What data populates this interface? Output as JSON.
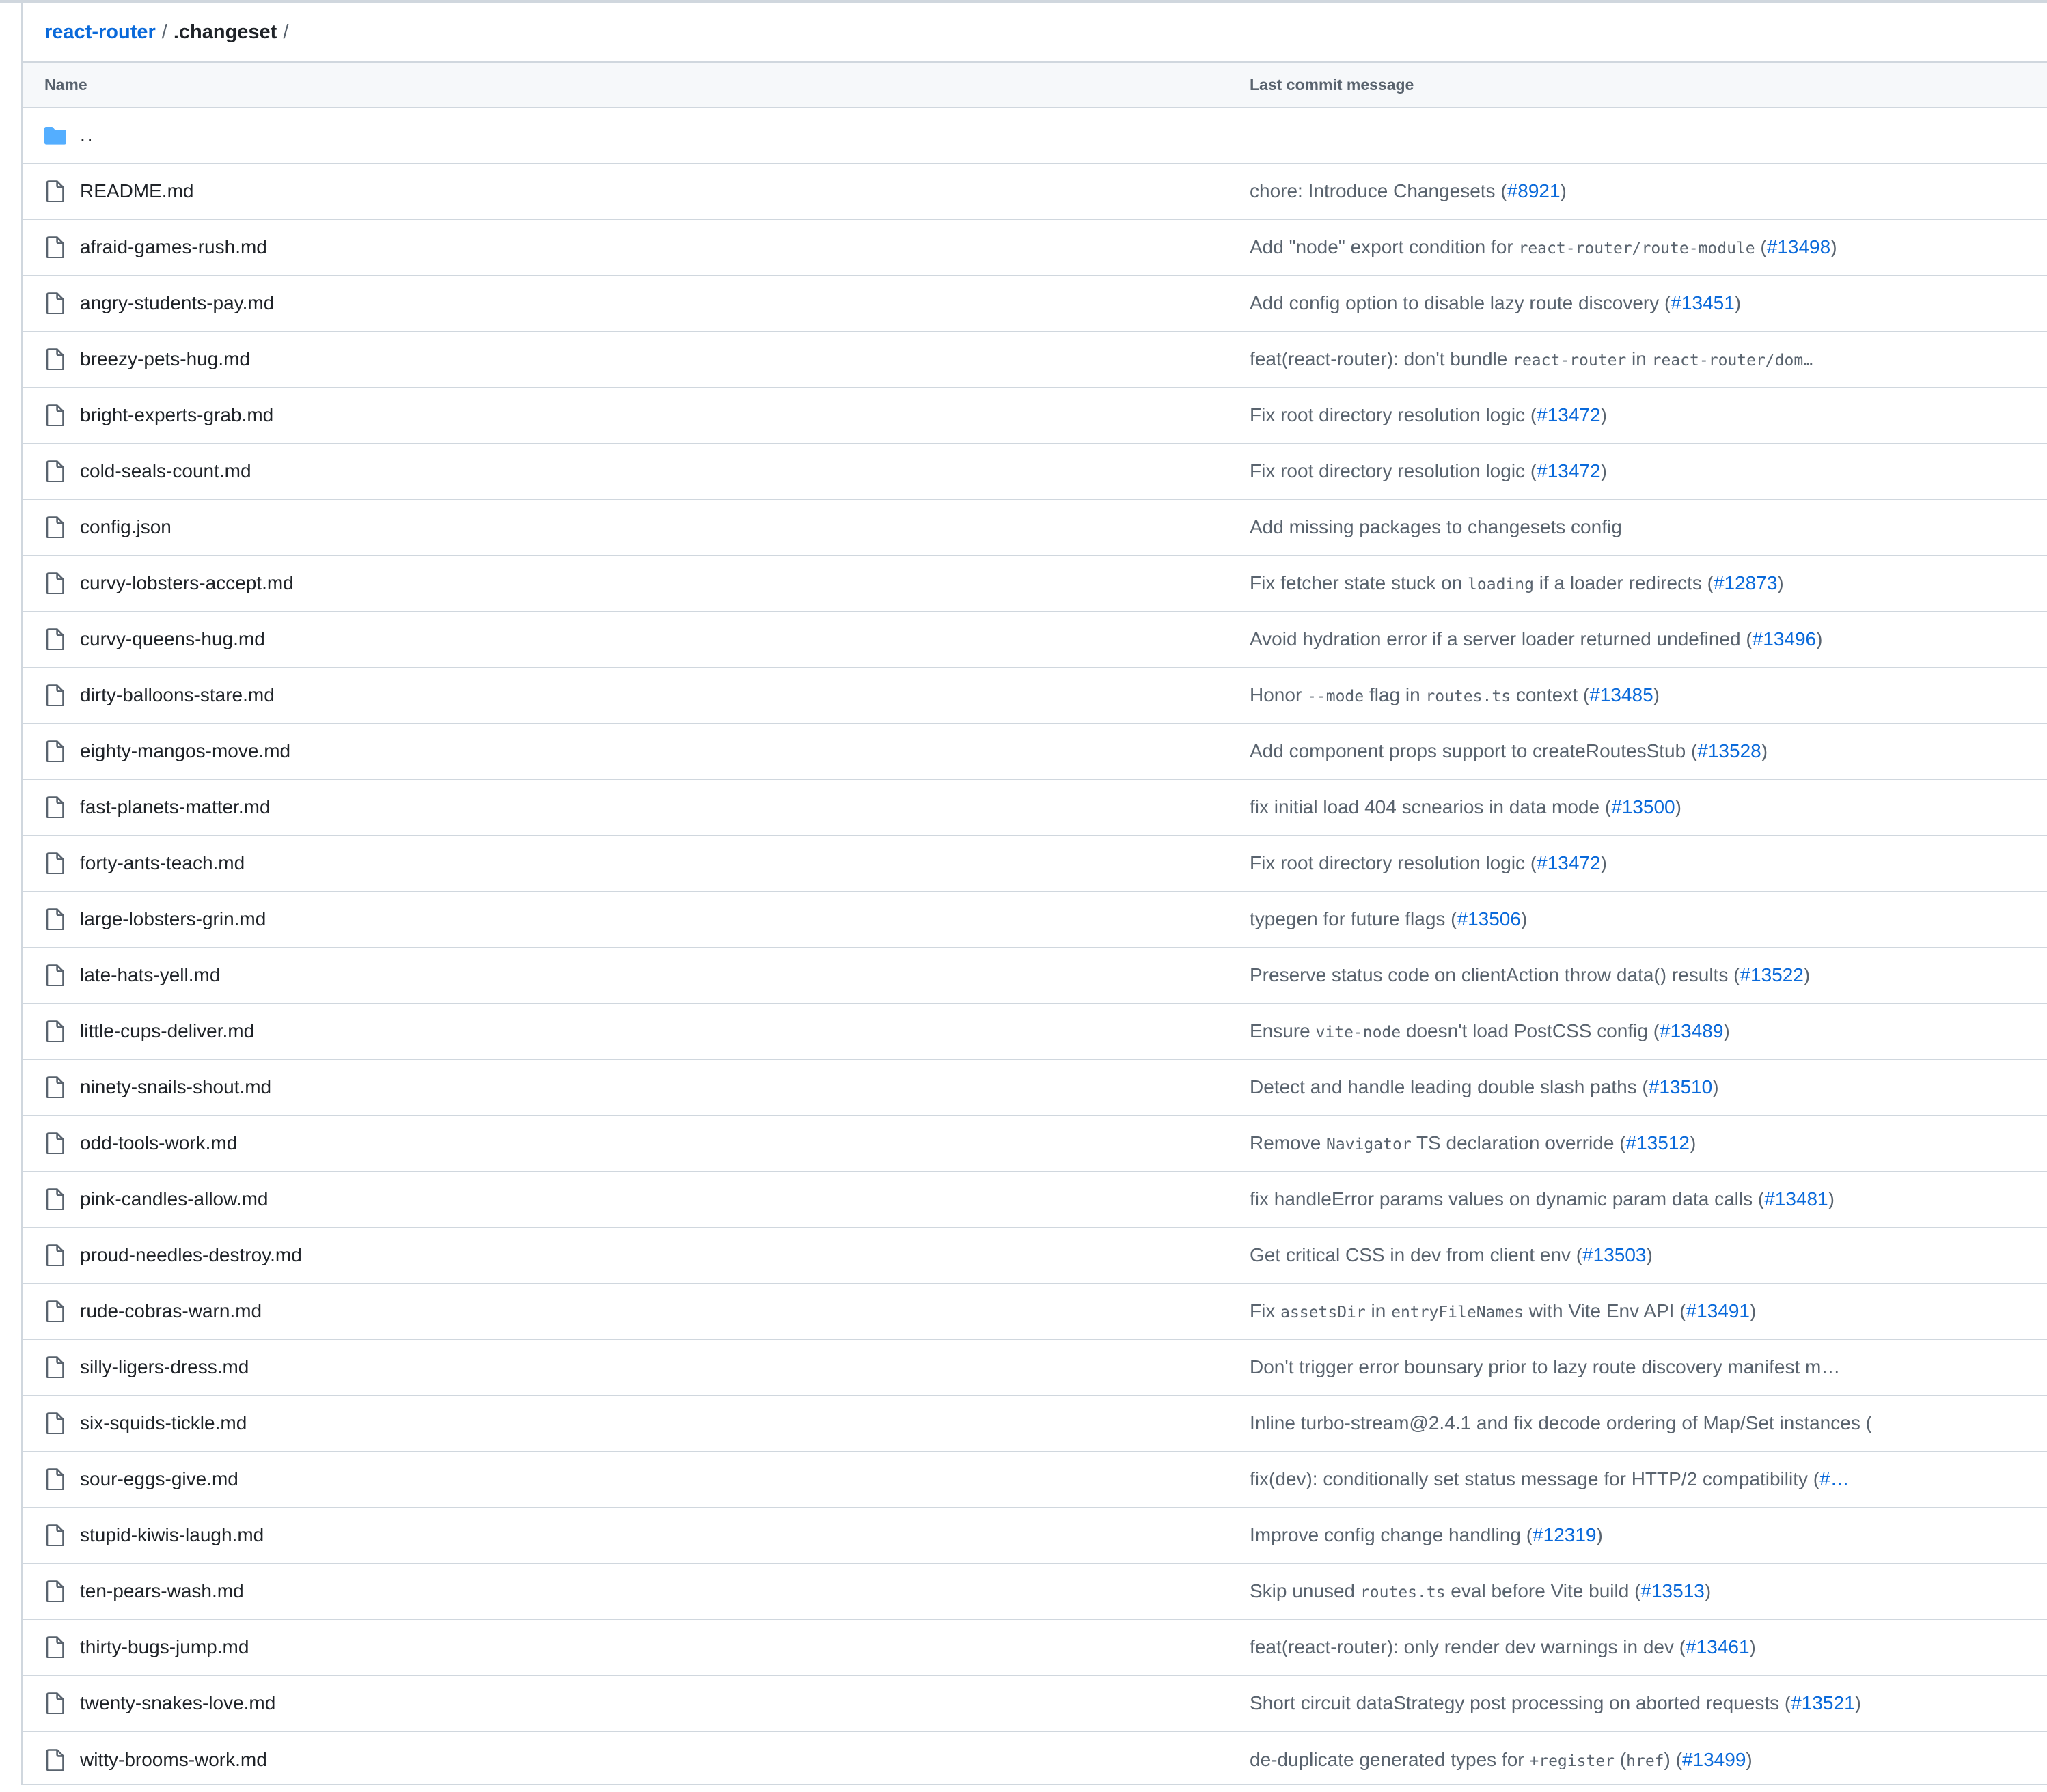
{
  "breadcrumb": {
    "repo": "react-router",
    "separator": "/",
    "folder": ".changeset",
    "trailing": "/"
  },
  "table": {
    "columns": {
      "name": "Name",
      "message": "Last commit message"
    },
    "parent_dir": "..",
    "rows": [
      {
        "name": "README.md",
        "message": [
          {
            "t": "chore: Introduce Changesets ("
          },
          {
            "t": "#8921",
            "pr": true
          },
          {
            "t": ")"
          }
        ]
      },
      {
        "name": "afraid-games-rush.md",
        "message": [
          {
            "t": "Add \"node\" export condition for "
          },
          {
            "t": "react-router/route-module",
            "code": true
          },
          {
            "t": " ("
          },
          {
            "t": "#13498",
            "pr": true
          },
          {
            "t": ")"
          }
        ]
      },
      {
        "name": "angry-students-pay.md",
        "message": [
          {
            "t": "Add config option to disable lazy route discovery ("
          },
          {
            "t": "#13451",
            "pr": true
          },
          {
            "t": ")"
          }
        ]
      },
      {
        "name": "breezy-pets-hug.md",
        "message": [
          {
            "t": "feat(react-router): don't bundle "
          },
          {
            "t": "react-router",
            "code": true
          },
          {
            "t": " in "
          },
          {
            "t": "react-router/dom…",
            "code": true
          }
        ]
      },
      {
        "name": "bright-experts-grab.md",
        "message": [
          {
            "t": "Fix root directory resolution logic ("
          },
          {
            "t": "#13472",
            "pr": true
          },
          {
            "t": ")"
          }
        ]
      },
      {
        "name": "cold-seals-count.md",
        "message": [
          {
            "t": "Fix root directory resolution logic ("
          },
          {
            "t": "#13472",
            "pr": true
          },
          {
            "t": ")"
          }
        ]
      },
      {
        "name": "config.json",
        "message": [
          {
            "t": "Add missing packages to changesets config"
          }
        ]
      },
      {
        "name": "curvy-lobsters-accept.md",
        "message": [
          {
            "t": "Fix fetcher state stuck on "
          },
          {
            "t": "loading",
            "code": true
          },
          {
            "t": " if a loader redirects ("
          },
          {
            "t": "#12873",
            "pr": true
          },
          {
            "t": ")"
          }
        ]
      },
      {
        "name": "curvy-queens-hug.md",
        "message": [
          {
            "t": "Avoid hydration error if a server loader returned undefined ("
          },
          {
            "t": "#13496",
            "pr": true
          },
          {
            "t": ")"
          }
        ]
      },
      {
        "name": "dirty-balloons-stare.md",
        "message": [
          {
            "t": "Honor "
          },
          {
            "t": "--mode",
            "code": true
          },
          {
            "t": " flag in "
          },
          {
            "t": "routes.ts",
            "code": true
          },
          {
            "t": " context ("
          },
          {
            "t": "#13485",
            "pr": true
          },
          {
            "t": ")"
          }
        ]
      },
      {
        "name": "eighty-mangos-move.md",
        "message": [
          {
            "t": "Add component props support to createRoutesStub ("
          },
          {
            "t": "#13528",
            "pr": true
          },
          {
            "t": ")"
          }
        ]
      },
      {
        "name": "fast-planets-matter.md",
        "message": [
          {
            "t": "fix initial load 404 scnearios in data mode ("
          },
          {
            "t": "#13500",
            "pr": true
          },
          {
            "t": ")"
          }
        ]
      },
      {
        "name": "forty-ants-teach.md",
        "message": [
          {
            "t": "Fix root directory resolution logic ("
          },
          {
            "t": "#13472",
            "pr": true
          },
          {
            "t": ")"
          }
        ]
      },
      {
        "name": "large-lobsters-grin.md",
        "message": [
          {
            "t": "typegen for future flags ("
          },
          {
            "t": "#13506",
            "pr": true
          },
          {
            "t": ")"
          }
        ]
      },
      {
        "name": "late-hats-yell.md",
        "message": [
          {
            "t": "Preserve status code on clientAction throw data() results ("
          },
          {
            "t": "#13522",
            "pr": true
          },
          {
            "t": ")"
          }
        ]
      },
      {
        "name": "little-cups-deliver.md",
        "message": [
          {
            "t": "Ensure "
          },
          {
            "t": "vite-node",
            "code": true
          },
          {
            "t": " doesn't load PostCSS config ("
          },
          {
            "t": "#13489",
            "pr": true
          },
          {
            "t": ")"
          }
        ]
      },
      {
        "name": "ninety-snails-shout.md",
        "message": [
          {
            "t": "Detect and handle leading double slash paths ("
          },
          {
            "t": "#13510",
            "pr": true
          },
          {
            "t": ")"
          }
        ]
      },
      {
        "name": "odd-tools-work.md",
        "message": [
          {
            "t": "Remove "
          },
          {
            "t": "Navigator",
            "code": true
          },
          {
            "t": " TS declaration override ("
          },
          {
            "t": "#13512",
            "pr": true
          },
          {
            "t": ")"
          }
        ]
      },
      {
        "name": "pink-candles-allow.md",
        "message": [
          {
            "t": "fix handleError params values on dynamic param data calls ("
          },
          {
            "t": "#13481",
            "pr": true
          },
          {
            "t": ")"
          }
        ]
      },
      {
        "name": "proud-needles-destroy.md",
        "message": [
          {
            "t": "Get critical CSS in dev from client env ("
          },
          {
            "t": "#13503",
            "pr": true
          },
          {
            "t": ")"
          }
        ]
      },
      {
        "name": "rude-cobras-warn.md",
        "message": [
          {
            "t": "Fix "
          },
          {
            "t": "assetsDir",
            "code": true
          },
          {
            "t": " in "
          },
          {
            "t": "entryFileNames",
            "code": true
          },
          {
            "t": " with Vite Env API ("
          },
          {
            "t": "#13491",
            "pr": true
          },
          {
            "t": ")"
          }
        ]
      },
      {
        "name": "silly-ligers-dress.md",
        "message": [
          {
            "t": "Don't trigger error bounsary prior to lazy route discovery manifest m…"
          }
        ]
      },
      {
        "name": "six-squids-tickle.md",
        "message": [
          {
            "t": "Inline turbo-stream@2.4.1 and fix decode ordering of Map/Set instances ("
          }
        ]
      },
      {
        "name": "sour-eggs-give.md",
        "message": [
          {
            "t": "fix(dev): conditionally set status message for HTTP/2 compatibility ("
          },
          {
            "t": "#…",
            "pr": true
          }
        ]
      },
      {
        "name": "stupid-kiwis-laugh.md",
        "message": [
          {
            "t": "Improve config change handling ("
          },
          {
            "t": "#12319",
            "pr": true
          },
          {
            "t": ")"
          }
        ]
      },
      {
        "name": "ten-pears-wash.md",
        "message": [
          {
            "t": "Skip unused "
          },
          {
            "t": "routes.ts",
            "code": true
          },
          {
            "t": " eval before Vite build ("
          },
          {
            "t": "#13513",
            "pr": true
          },
          {
            "t": ")"
          }
        ]
      },
      {
        "name": "thirty-bugs-jump.md",
        "message": [
          {
            "t": "feat(react-router): only render dev warnings in dev ("
          },
          {
            "t": "#13461",
            "pr": true
          },
          {
            "t": ")"
          }
        ]
      },
      {
        "name": "twenty-snakes-love.md",
        "message": [
          {
            "t": "Short circuit dataStrategy post processing on aborted requests ("
          },
          {
            "t": "#13521",
            "pr": true
          },
          {
            "t": ")"
          }
        ]
      },
      {
        "name": "witty-brooms-work.md",
        "message": [
          {
            "t": "de-duplicate generated types for "
          },
          {
            "t": "+register",
            "code": true
          },
          {
            "t": " ("
          },
          {
            "t": "href",
            "code": true
          },
          {
            "t": ") ("
          },
          {
            "t": "#13499",
            "pr": true
          },
          {
            "t": ")"
          }
        ]
      }
    ]
  },
  "colors": {
    "link": "#0969da",
    "text": "#1f2328",
    "muted": "#59636e",
    "border": "#d0d7de",
    "header_bg": "#f6f8fa",
    "folder_icon": "#54aeff"
  },
  "icons": {
    "parent": "folder-icon",
    "file": "file-icon"
  }
}
